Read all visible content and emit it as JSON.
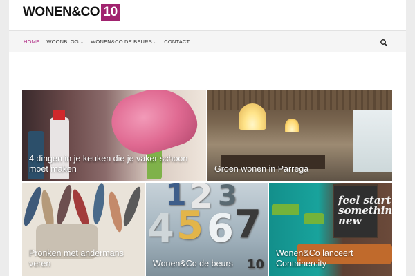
{
  "header": {
    "logo_text": "WONEN&CO",
    "logo_badge": "10"
  },
  "nav": {
    "items": [
      {
        "label": "HOME",
        "active": true,
        "has_dropdown": false
      },
      {
        "label": "WOONBLOG",
        "active": false,
        "has_dropdown": true
      },
      {
        "label": "WONEN&CO DE BEURS",
        "active": false,
        "has_dropdown": true
      },
      {
        "label": "CONTACT",
        "active": false,
        "has_dropdown": false
      }
    ],
    "search_icon": "search-icon",
    "dropdown_icon": "⌄"
  },
  "tiles": [
    {
      "caption": "4 dingen in je keuken die je vaker schoon moet maken"
    },
    {
      "caption": "Groen wonen in Parrega"
    },
    {
      "caption": "Pronken met andermans veren"
    },
    {
      "caption": "Wonen&Co de beurs"
    },
    {
      "caption": "Wonen&Co lanceert Containercity"
    }
  ],
  "tile_art": {
    "beurs_numbers": [
      "1",
      "2",
      "3",
      "4",
      "5",
      "6",
      "7",
      "10"
    ],
    "board_text": "feel start something new"
  },
  "colors": {
    "accent": "#b02a84",
    "logo_badge_bg": "#a1236f"
  }
}
